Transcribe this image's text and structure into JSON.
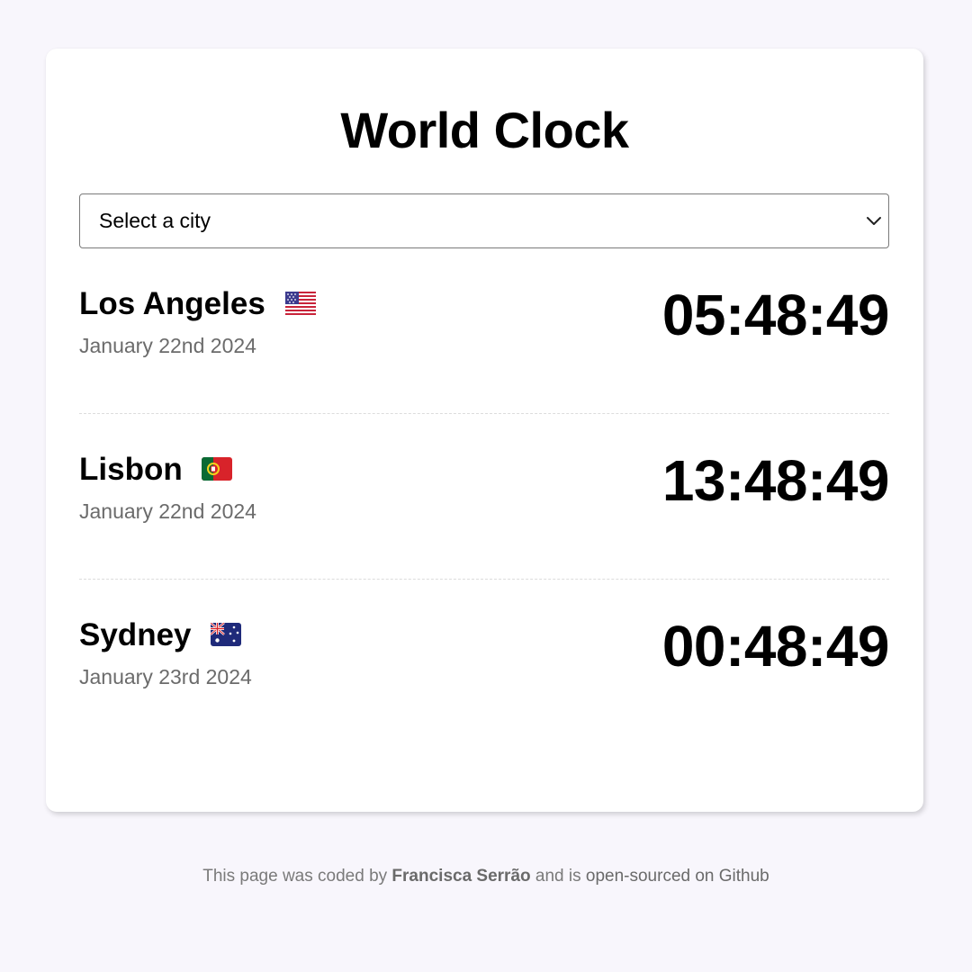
{
  "page_title": "World Clock",
  "city_select": {
    "selected_label": "Select a city"
  },
  "cities": [
    {
      "name": "Los Angeles",
      "flag": "us-flag-icon",
      "date": "January 22nd 2024",
      "time": "05:48:49"
    },
    {
      "name": "Lisbon",
      "flag": "portugal-flag-icon",
      "date": "January 22nd 2024",
      "time": "13:48:49"
    },
    {
      "name": "Sydney",
      "flag": "australia-flag-icon",
      "date": "January 23rd 2024",
      "time": "00:48:49"
    }
  ],
  "footer": {
    "prefix": "This page was coded by ",
    "author": "Francisca Serrão",
    "middle": " and is ",
    "link": "open-sourced on Github"
  },
  "colors": {
    "background": "#f8f6fc",
    "card": "#ffffff",
    "muted_text": "#6b6b6b"
  }
}
